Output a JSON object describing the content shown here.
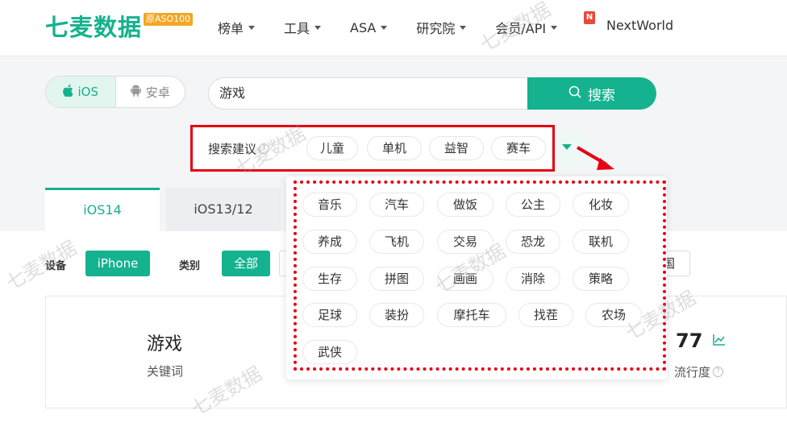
{
  "logo": {
    "name": "七麦数据",
    "badge": "原ASO100"
  },
  "nav": {
    "items": [
      {
        "label": "榜单"
      },
      {
        "label": "工具"
      },
      {
        "label": "ASA"
      },
      {
        "label": "研究院"
      },
      {
        "label": "会员/API"
      }
    ],
    "new_badge": "N",
    "extra": "NextWorld"
  },
  "platform": {
    "ios": "iOS",
    "android": "安卓"
  },
  "search": {
    "value": "游戏",
    "button": "搜索"
  },
  "suggestions": {
    "label": "搜索建议",
    "chips": [
      "儿童",
      "单机",
      "益智",
      "赛车"
    ],
    "more": [
      "音乐",
      "汽车",
      "做饭",
      "公主",
      "化妆",
      "养成",
      "飞机",
      "交易",
      "恐龙",
      "联机",
      "生存",
      "拼图",
      "画画",
      "消除",
      "策略",
      "足球",
      "装扮",
      "摩托车",
      "找茬",
      "农场",
      "武侠"
    ]
  },
  "tabs": {
    "ios14": "iOS14",
    "ios13": "iOS13/12"
  },
  "filters": {
    "device_label": "设备",
    "device_value": "iPhone",
    "category_label": "类别",
    "category_value": "全部",
    "region_partial": "国"
  },
  "card": {
    "keyword": "游戏",
    "keyword_label": "关键词",
    "popularity_value": "77",
    "popularity_label": "流行度"
  },
  "colors": {
    "brand": "#14b28e",
    "highlight_red": "#e60012"
  },
  "watermark": "七麦数据"
}
